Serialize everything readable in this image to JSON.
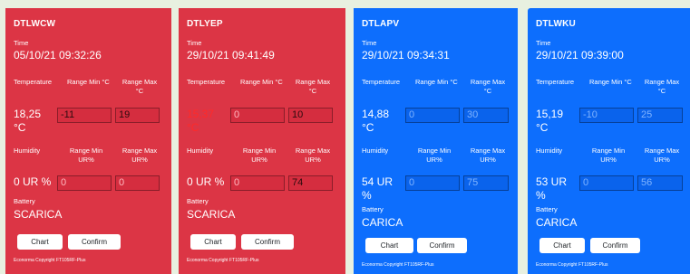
{
  "labels": {
    "time": "Time",
    "temperature": "Temperature",
    "range_min_c": "Range Min °C",
    "range_max_c_line1": "Range Max",
    "range_max_c_line2": "°C",
    "humidity": "Humidity",
    "range_min_ur_line1": "Range Min",
    "range_min_ur_line2": "UR%",
    "range_max_ur_line1": "Range Max",
    "range_max_ur_line2": "UR%",
    "battery": "Battery",
    "chart_button": "Chart",
    "confirm_button": "Confirm",
    "copyright": "Econorma Copyright FT105RF-Plus"
  },
  "colors": {
    "alarm": "#dc3545",
    "ok": "#0d6efd",
    "alarm_text": "#ff2a2a"
  },
  "cards": [
    {
      "status": "alarm",
      "device": "DTLWCW",
      "time": "05/10/21 09:32:26",
      "temperature_value": "18,25",
      "temperature_unit": "°C",
      "temp_range_min": "-11",
      "temp_range_max": "19",
      "humidity_value": "0 UR %",
      "hum_range_min": "0",
      "hum_range_max": "0",
      "battery": "SCARICA"
    },
    {
      "status": "alarm",
      "device": "DTLYEP",
      "time": "29/10/21 09:41:49",
      "temperature_value": "15,37",
      "temperature_unit": "°C",
      "temp_range_min": "0",
      "temp_range_max": "10",
      "humidity_value": "0 UR %",
      "hum_range_min": "0",
      "hum_range_max": "74",
      "battery": "SCARICA"
    },
    {
      "status": "ok",
      "device": "DTLAPV",
      "time": "29/10/21 09:34:31",
      "temperature_value": "14,88",
      "temperature_unit": "°C",
      "temp_range_min": "0",
      "temp_range_max": "30",
      "humidity_value_line1": "54 UR",
      "humidity_value_line2": "%",
      "hum_range_min": "0",
      "hum_range_max": "75",
      "battery": "CARICA"
    },
    {
      "status": "ok",
      "device": "DTLWKU",
      "time": "29/10/21 09:39:00",
      "temperature_value": "15,19",
      "temperature_unit": "°C",
      "temp_range_min": "-10",
      "temp_range_max": "25",
      "humidity_value_line1": "53 UR",
      "humidity_value_line2": "%",
      "hum_range_min": "0",
      "hum_range_max": "56",
      "battery": "CARICA"
    }
  ]
}
